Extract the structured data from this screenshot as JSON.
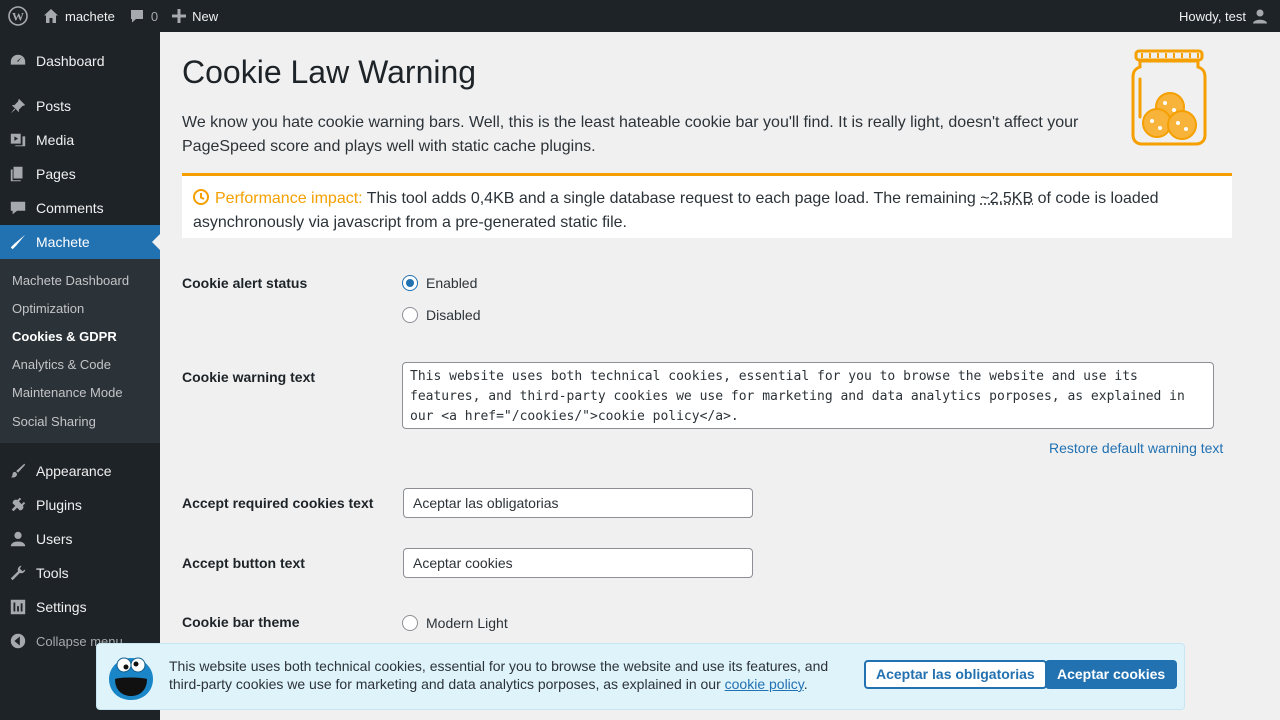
{
  "admin_bar": {
    "site_name": "machete",
    "comments_count": "0",
    "new_label": "New",
    "howdy": "Howdy, test"
  },
  "sidebar": {
    "items": [
      {
        "label": "Dashboard",
        "icon": "dashboard-icon"
      },
      {
        "label": "Posts",
        "icon": "pin-icon"
      },
      {
        "label": "Media",
        "icon": "media-icon"
      },
      {
        "label": "Pages",
        "icon": "pages-icon"
      },
      {
        "label": "Comments",
        "icon": "comment-icon"
      },
      {
        "label": "Machete",
        "icon": "machete-icon"
      },
      {
        "label": "Appearance",
        "icon": "brush-icon"
      },
      {
        "label": "Plugins",
        "icon": "plug-icon"
      },
      {
        "label": "Users",
        "icon": "user-icon"
      },
      {
        "label": "Tools",
        "icon": "wrench-icon"
      },
      {
        "label": "Settings",
        "icon": "settings-icon"
      },
      {
        "label": "Collapse menu",
        "icon": "collapse-icon"
      }
    ],
    "submenu": [
      "Machete Dashboard",
      "Optimization",
      "Cookies & GDPR",
      "Analytics & Code",
      "Maintenance Mode",
      "Social Sharing"
    ]
  },
  "page": {
    "title": "Cookie Law Warning",
    "intro": "We know you hate cookie warning bars. Well, this is the least hateable cookie bar you'll find. It is really light, doesn't affect your PageSpeed score and plays well with static cache plugins.",
    "notice": {
      "label": "Performance impact:",
      "text_before": " This tool adds 0,4KB and a single database request to each page load. The remaining ",
      "abbr": "~2.5KB",
      "text_after": " of code is loaded asynchronously via javascript from a pre-generated static file."
    }
  },
  "form": {
    "status_label": "Cookie alert status",
    "enabled_label": "Enabled",
    "disabled_label": "Disabled",
    "warning_text_label": "Cookie warning text",
    "warning_text_value": "This website uses both technical cookies, essential for you to browse the website and use its features, and third-party cookies we use for marketing and data analytics porposes, as explained in our <a href=\"/cookies/\">cookie policy</a>.",
    "restore_link": "Restore default warning text",
    "accept_required_label": "Accept required cookies text",
    "accept_required_value": "Aceptar las obligatorias",
    "accept_button_label": "Accept button text",
    "accept_button_value": "Aceptar cookies",
    "theme_label": "Cookie bar theme",
    "theme_option": "Modern Light"
  },
  "cookie_bar": {
    "text": "This website uses both technical cookies, essential for you to browse the website and use its features, and third-party cookies we use for marketing and data analytics porposes, as explained in our ",
    "link": "cookie policy",
    "text_end": ".",
    "btn_required": "Aceptar las obligatorias",
    "btn_accept": "Aceptar cookies"
  },
  "colors": {
    "accent": "#2271b1",
    "warning": "#f5a000",
    "sidebar_bg": "#1d2327"
  }
}
